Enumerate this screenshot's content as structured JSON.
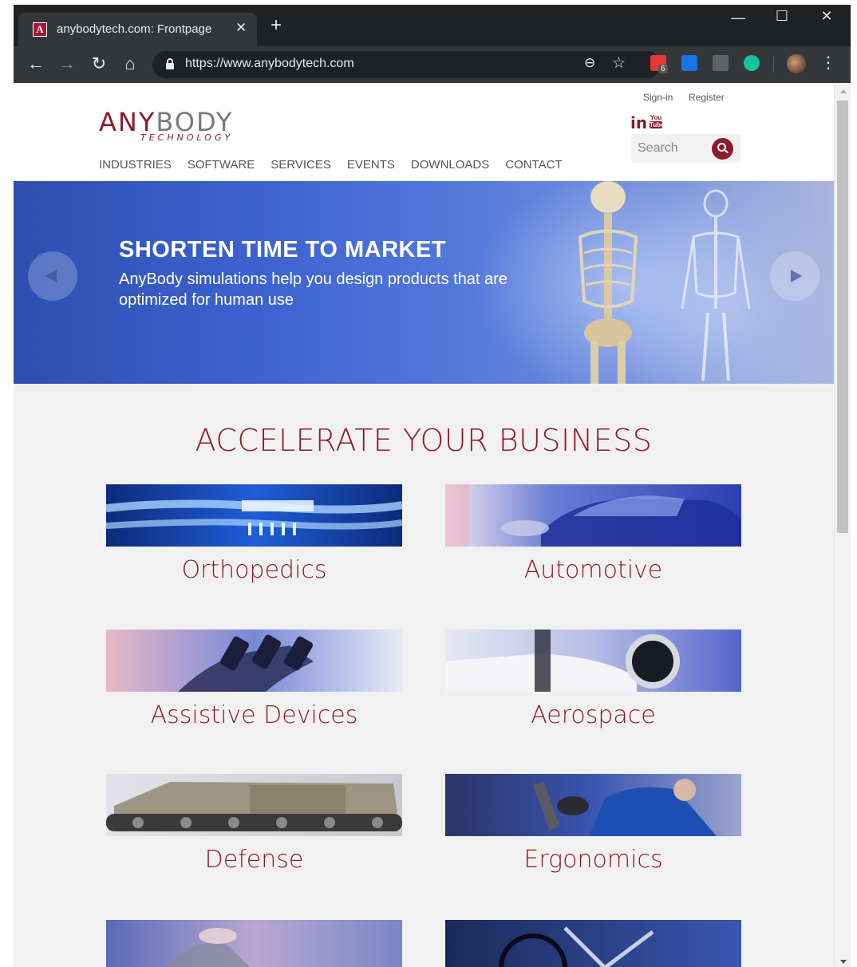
{
  "browser": {
    "tab_title": "anybodytech.com: Frontpage",
    "tab_favicon_letter": "A",
    "url": "https://www.anybodytech.com",
    "extension_badge": "6",
    "ext_colors": [
      "#e53935",
      "#1a73e8",
      "#5f6368",
      "#15c39a"
    ]
  },
  "header": {
    "logo_any": "ANY",
    "logo_body": "BODY",
    "logo_sub": "TECHNOLOGY",
    "sign_in": "Sign-in",
    "register": "Register",
    "linkedin": "in",
    "youtube_top": "You",
    "youtube_bottom": "Tube",
    "search_placeholder": "Search",
    "nav": [
      "INDUSTRIES",
      "SOFTWARE",
      "SERVICES",
      "EVENTS",
      "DOWNLOADS",
      "CONTACT"
    ]
  },
  "hero": {
    "title": "SHORTEN TIME TO MARKET",
    "text": "AnyBody simulations help you design products that are optimized for human use"
  },
  "section": {
    "title": "ACCELERATE YOUR BUSINESS"
  },
  "cards": [
    {
      "label": "Orthopedics"
    },
    {
      "label": "Automotive"
    },
    {
      "label": "Assistive Devices"
    },
    {
      "label": "Aerospace"
    },
    {
      "label": "Defense"
    },
    {
      "label": "Ergonomics"
    }
  ],
  "colors": {
    "brand": "#8c1b2b",
    "nav_text": "#555555",
    "chrome_dark": "#202124",
    "chrome_toolbar": "#35363a"
  }
}
